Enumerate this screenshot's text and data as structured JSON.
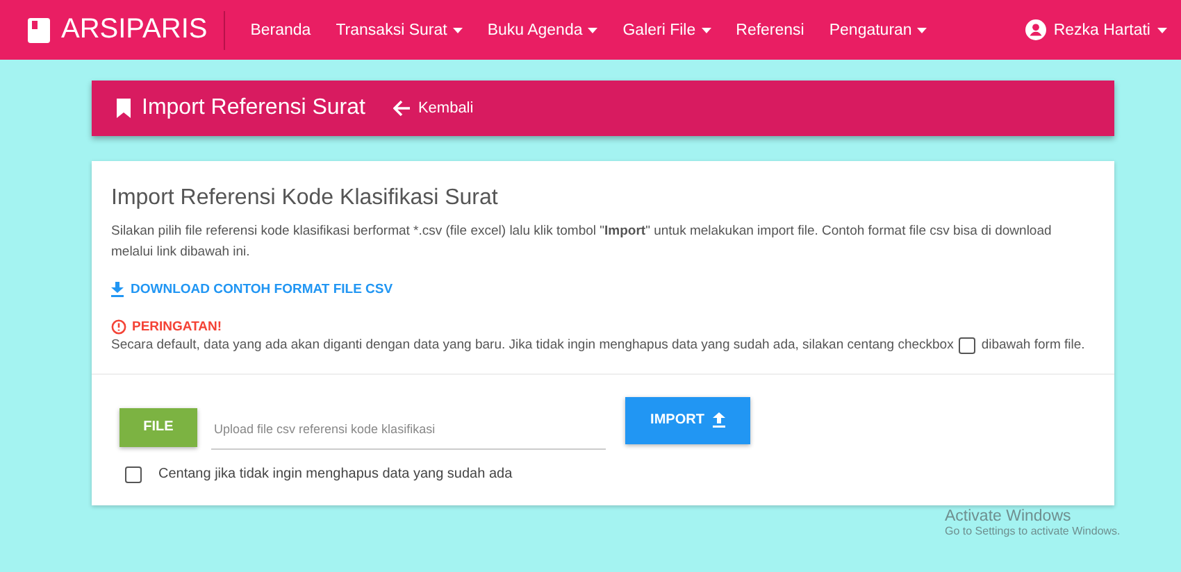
{
  "navbar": {
    "brand": "ARSIPARIS",
    "items": [
      {
        "label": "Beranda",
        "dropdown": false
      },
      {
        "label": "Transaksi Surat",
        "dropdown": true
      },
      {
        "label": "Buku Agenda",
        "dropdown": true
      },
      {
        "label": "Galeri File",
        "dropdown": true
      },
      {
        "label": "Referensi",
        "dropdown": false
      },
      {
        "label": "Pengaturan",
        "dropdown": true
      }
    ],
    "user": "Rezka Hartati"
  },
  "page_header": {
    "title": "Import Referensi Surat",
    "back_link": "Kembali"
  },
  "card": {
    "title": "Import Referensi Kode Klasifikasi Surat",
    "description": "Silakan pilih file referensi kode klasifikasi berformat *.csv (file excel) lalu klik tombol \"**Import**\" untuk melakukan import file. Contoh format file csv bisa di download melalui link dibawah ini.",
    "download_link": "DOWNLOAD CONTOH FORMAT FILE CSV",
    "warning_title": "PERINGATAN!",
    "warning_text_before": "Secara default, data yang ada akan diganti dengan data yang baru. Jika tidak ingin menghapus data yang sudah ada, silakan centang checkbox",
    "warning_text_after": "dibawah form file.",
    "file_button": "FILE",
    "file_placeholder": "Upload file csv referensi kode klasifikasi",
    "import_button": "IMPORT",
    "checkbox": {
      "label": "Centang jika tidak ingin menghapus data yang sudah ada",
      "checked": false
    }
  },
  "os_notice": {
    "title": "Activate Windows",
    "subtitle": "Go to Settings to activate Windows."
  }
}
